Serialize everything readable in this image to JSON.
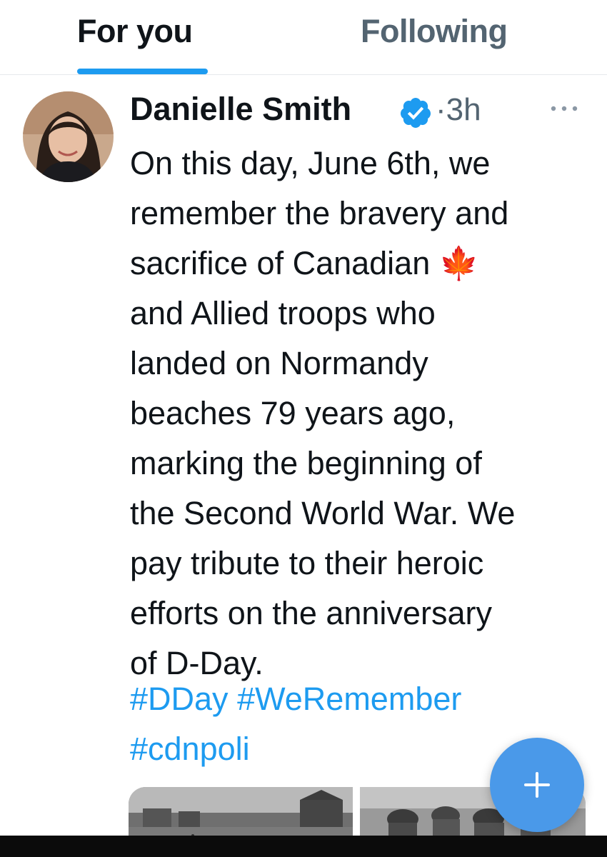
{
  "tabs": [
    {
      "label": "For you",
      "active": true
    },
    {
      "label": "Following",
      "active": false
    }
  ],
  "tweet": {
    "author_name": "Danielle Smith",
    "verified": true,
    "time": "·3h",
    "text": "On this day, June 6th, we\nremember the bravery and\nsacrifice of Canadian 🍁\nand Allied troops who\nlanded on Normandy\nbeaches 79 years ago,\nmarking the beginning of\nthe Second World War. We\npay tribute to their heroic\nefforts on the anniversary\nof D-Day.",
    "hashtags": [
      "#DDay",
      "#WeRemember",
      "#cdnpoli"
    ]
  },
  "icons": {
    "verified": "verified-badge-icon",
    "more": "more-options-icon",
    "compose": "plus-icon"
  },
  "colors": {
    "accent": "#1d9bf0",
    "compose_button": "#4a99e9",
    "secondary_text": "#536471"
  }
}
